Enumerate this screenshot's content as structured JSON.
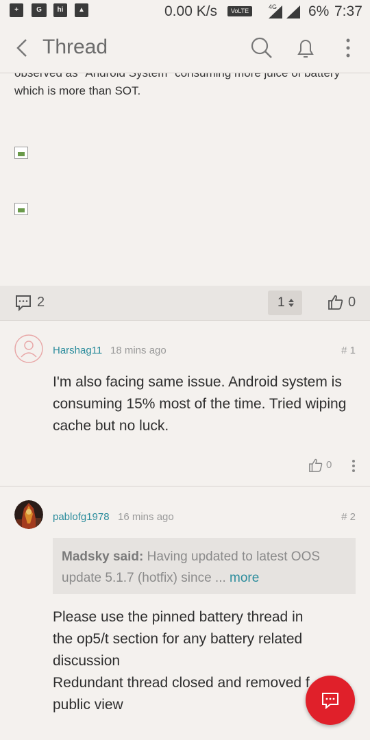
{
  "status_bar": {
    "speed": "0.00 K/s",
    "volte": "VoLTE",
    "network": "4G",
    "battery": "6%",
    "time": "7:37"
  },
  "app_bar": {
    "title": "Thread"
  },
  "post": {
    "text_cut": "observed as \"Android System\" consuming more juice of battery",
    "text_last": "which is more than SOT.",
    "comment_count": "2",
    "page": "1",
    "like_count": "0"
  },
  "replies": [
    {
      "author": "Harshag11",
      "time": "18 mins ago",
      "floor": "# 1",
      "text": "I'm also facing same issue. Android system is consuming 15% most of the time. Tried wiping cache but no luck.",
      "likes": "0"
    },
    {
      "author": "pablofg1978",
      "time": "16 mins ago",
      "floor": "# 2",
      "quote_author": "Madsky said:",
      "quote_text": "Having updated to latest OOS update 5.1.7 (hotfix) since ...",
      "quote_more": "more",
      "text_line1": "Please use the pinned battery thread in",
      "text_line2": "the op5/t section for any battery related",
      "text_line3": "discussion",
      "text_line4": "Redundant thread closed and removed f",
      "text_line5": "public view"
    }
  ],
  "colors": {
    "accent": "#2b8c9c",
    "fab": "#e0202a",
    "background": "#f4f1ee"
  }
}
